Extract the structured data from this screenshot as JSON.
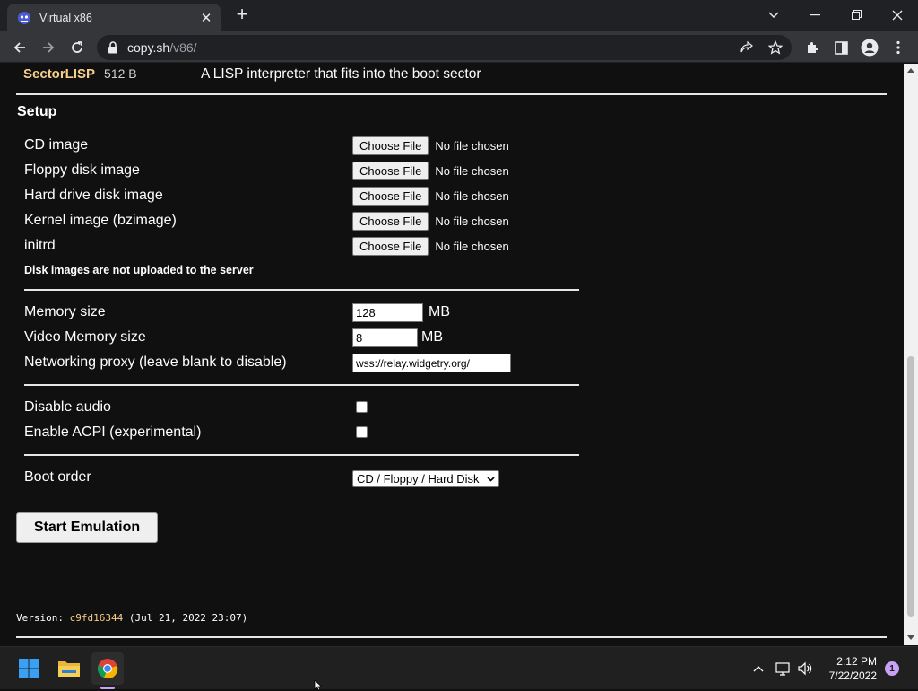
{
  "browser": {
    "tab_title": "Virtual x86",
    "url_host": "copy.sh",
    "url_path": "/v86/"
  },
  "page": {
    "os_entry": {
      "name": "SectorLISP",
      "size": "512 B",
      "description": "A LISP interpreter that fits into the boot sector"
    },
    "setup": {
      "title": "Setup",
      "file_inputs": [
        {
          "label": "CD image",
          "button": "Choose File",
          "status": "No file chosen"
        },
        {
          "label": "Floppy disk image",
          "button": "Choose File",
          "status": "No file chosen"
        },
        {
          "label": "Hard drive disk image",
          "button": "Choose File",
          "status": "No file chosen"
        },
        {
          "label": "Kernel image (bzimage)",
          "button": "Choose File",
          "status": "No file chosen"
        },
        {
          "label": "initrd",
          "button": "Choose File",
          "status": "No file chosen"
        }
      ],
      "upload_note": "Disk images are not uploaded to the server",
      "memory": {
        "label": "Memory size",
        "value": "128",
        "unit": "MB"
      },
      "video_memory": {
        "label": "Video Memory size",
        "value": "8",
        "unit": "MB"
      },
      "proxy": {
        "label": "Networking proxy (leave blank to disable)",
        "value": "wss://relay.widgetry.org/"
      },
      "disable_audio": {
        "label": "Disable audio",
        "checked": false
      },
      "enable_acpi": {
        "label": "Enable ACPI (experimental)",
        "checked": false
      },
      "boot_order": {
        "label": "Boot order",
        "selected": "CD / Floppy / Hard Disk"
      },
      "start_button": "Start Emulation"
    },
    "version": {
      "prefix": "Version: ",
      "hash": "c9fd16344",
      "date": " (Jul 21, 2022 23:07)"
    }
  },
  "taskbar": {
    "time": "2:12 PM",
    "date": "7/22/2022",
    "notifications": "1"
  }
}
